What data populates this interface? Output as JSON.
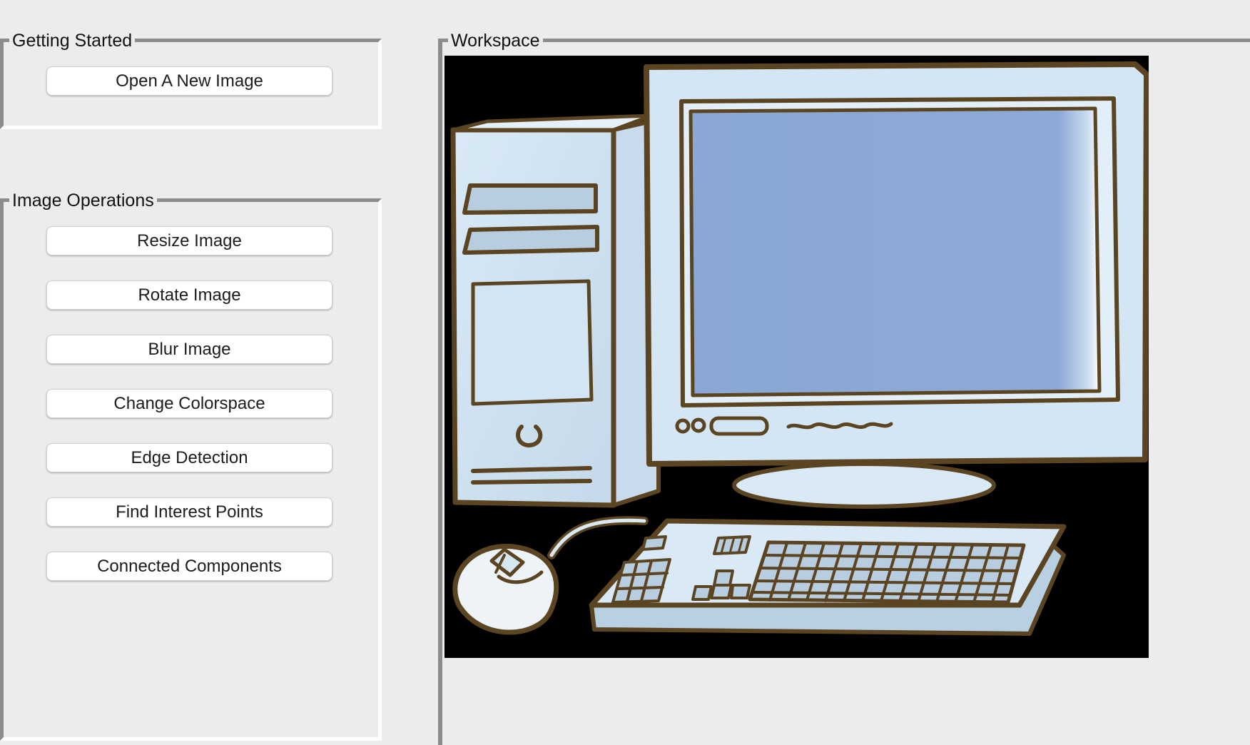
{
  "getting_started": {
    "title": "Getting Started",
    "open_button": "Open A New Image"
  },
  "image_operations": {
    "title": "Image Operations",
    "buttons": [
      "Resize Image",
      "Rotate Image",
      "Blur Image",
      "Change Colorspace",
      "Edge Detection",
      "Find Interest Points",
      "Connected Components"
    ]
  },
  "workspace": {
    "title": "Workspace",
    "image": {
      "subject": "desktop-computer-illustration",
      "background_color": "#000000",
      "outline_color": "#5a4422",
      "body_color": "#d6e6f3",
      "screen_color": "#8ba9d4"
    }
  },
  "colors": {
    "window_background": "#ececec",
    "groupbox_border": "#8c8c8c",
    "button_background": "#ffffff"
  }
}
